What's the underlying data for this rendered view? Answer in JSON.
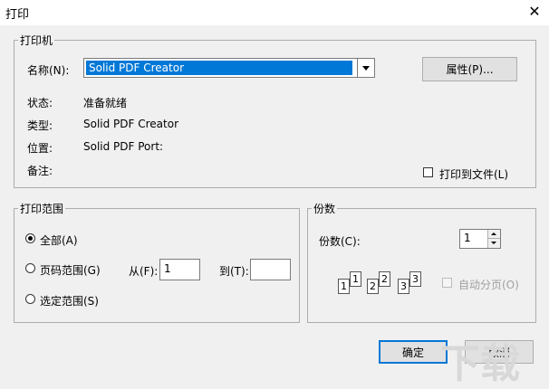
{
  "window": {
    "title": "打印",
    "close_glyph": "✕"
  },
  "printer": {
    "legend": "打印机",
    "name_label": "名称(N):",
    "name_value": "Solid PDF Creator",
    "properties_button": "属性(P)...",
    "status_label": "状态:",
    "status_value": "准备就绪",
    "type_label": "类型:",
    "type_value": "Solid PDF Creator",
    "where_label": "位置:",
    "where_value": "Solid PDF Port:",
    "comment_label": "备注:",
    "comment_value": "",
    "print_to_file": {
      "label": "打印到文件(L)",
      "checked": false
    }
  },
  "range": {
    "legend": "打印范围",
    "all": {
      "label": "全部(A)",
      "selected": true
    },
    "pages": {
      "label": "页码范围(G)",
      "selected": false
    },
    "from_label": "从(F):",
    "from_value": "1",
    "to_label": "到(T):",
    "to_value": "",
    "selection": {
      "label": "选定范围(S)",
      "selected": false
    }
  },
  "copies": {
    "legend": "份数",
    "count_label": "份数(C):",
    "count_value": "1",
    "collate": {
      "label": "自动分页(O)",
      "checked": false,
      "enabled": false
    },
    "collate_pages": [
      "1",
      "1",
      "2",
      "2",
      "3",
      "3"
    ]
  },
  "buttons": {
    "ok": "确定",
    "cancel": "取消"
  },
  "watermark": "下载"
}
